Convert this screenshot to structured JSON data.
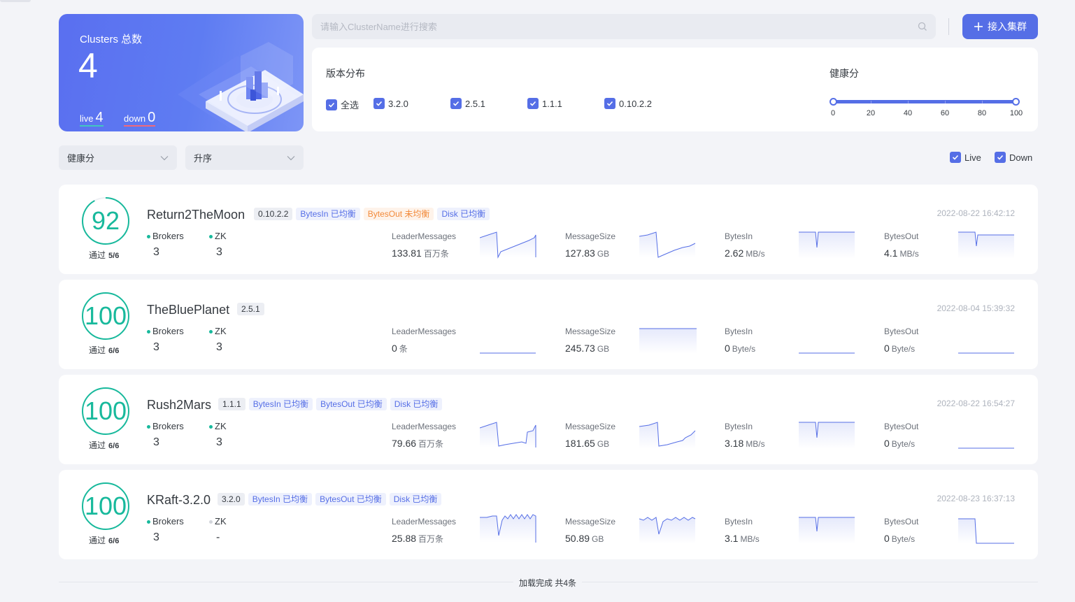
{
  "summary": {
    "title": "Clusters 总数",
    "total": "4",
    "live_label": "live",
    "live_value": "4",
    "down_label": "down",
    "down_value": "0"
  },
  "search": {
    "placeholder": "请输入ClusterName进行搜索"
  },
  "add_button": {
    "label": "接入集群"
  },
  "filters": {
    "version_label": "版本分布",
    "versions": [
      "全选",
      "3.2.0",
      "2.5.1",
      "1.1.1",
      "0.10.2.2"
    ],
    "health_label": "健康分",
    "health_ticks": [
      "0",
      "20",
      "40",
      "60",
      "80",
      "100"
    ],
    "health_range": [
      0,
      100
    ]
  },
  "sort": {
    "field": "健康分",
    "order": "升序"
  },
  "status_filter": {
    "live": "Live",
    "down": "Down"
  },
  "colors": {
    "accent": "#556ee6",
    "health": "#18b99c",
    "warn": "#f28a3a"
  },
  "clusters": [
    {
      "score": "92",
      "pass_label": "通过",
      "pass": "5/6",
      "name": "Return2TheMoon",
      "tags": [
        {
          "text": "0.10.2.2",
          "kind": "ver"
        },
        {
          "text": "BytesIn 已均衡",
          "kind": "ok"
        },
        {
          "text": "BytesOut 未均衡",
          "kind": "warn"
        },
        {
          "text": "Disk 已均衡",
          "kind": "ok"
        }
      ],
      "time": "2022-08-22 16:42:12",
      "brokers_label": "Brokers",
      "brokers": "3",
      "zk_label": "ZK",
      "zk": "3",
      "metrics": [
        {
          "label": "LeaderMessages",
          "value": "133.81",
          "unit": "百万条"
        },
        {
          "label": "MessageSize",
          "value": "127.83",
          "unit": "GB"
        },
        {
          "label": "BytesIn",
          "value": "2.62",
          "unit": "MB/s"
        },
        {
          "label": "BytesOut",
          "value": "4.1",
          "unit": "MB/s"
        }
      ]
    },
    {
      "score": "100",
      "pass_label": "通过",
      "pass": "6/6",
      "name": "TheBluePlanet",
      "tags": [
        {
          "text": "2.5.1",
          "kind": "ver"
        }
      ],
      "time": "2022-08-04 15:39:32",
      "brokers_label": "Brokers",
      "brokers": "3",
      "zk_label": "ZK",
      "zk": "3",
      "metrics": [
        {
          "label": "LeaderMessages",
          "value": "0",
          "unit": "条"
        },
        {
          "label": "MessageSize",
          "value": "245.73",
          "unit": "GB"
        },
        {
          "label": "BytesIn",
          "value": "0",
          "unit": "Byte/s"
        },
        {
          "label": "BytesOut",
          "value": "0",
          "unit": "Byte/s"
        }
      ]
    },
    {
      "score": "100",
      "pass_label": "通过",
      "pass": "6/6",
      "name": "Rush2Mars",
      "tags": [
        {
          "text": "1.1.1",
          "kind": "ver"
        },
        {
          "text": "BytesIn 已均衡",
          "kind": "ok"
        },
        {
          "text": "BytesOut 已均衡",
          "kind": "ok"
        },
        {
          "text": "Disk 已均衡",
          "kind": "ok"
        }
      ],
      "time": "2022-08-22 16:54:27",
      "brokers_label": "Brokers",
      "brokers": "3",
      "zk_label": "ZK",
      "zk": "3",
      "metrics": [
        {
          "label": "LeaderMessages",
          "value": "79.66",
          "unit": "百万条"
        },
        {
          "label": "MessageSize",
          "value": "181.65",
          "unit": "GB"
        },
        {
          "label": "BytesIn",
          "value": "3.18",
          "unit": "MB/s"
        },
        {
          "label": "BytesOut",
          "value": "0",
          "unit": "Byte/s"
        }
      ]
    },
    {
      "score": "100",
      "pass_label": "通过",
      "pass": "6/6",
      "name": "KRaft-3.2.0",
      "tags": [
        {
          "text": "3.2.0",
          "kind": "ver"
        },
        {
          "text": "BytesIn 已均衡",
          "kind": "ok"
        },
        {
          "text": "BytesOut 已均衡",
          "kind": "ok"
        },
        {
          "text": "Disk 已均衡",
          "kind": "ok"
        }
      ],
      "time": "2022-08-23 16:37:13",
      "brokers_label": "Brokers",
      "brokers": "3",
      "zk_label": "ZK",
      "zk": "-",
      "metrics": [
        {
          "label": "LeaderMessages",
          "value": "25.88",
          "unit": "百万条"
        },
        {
          "label": "MessageSize",
          "value": "50.89",
          "unit": "GB"
        },
        {
          "label": "BytesIn",
          "value": "3.1",
          "unit": "MB/s"
        },
        {
          "label": "BytesOut",
          "value": "0",
          "unit": "Byte/s"
        }
      ]
    }
  ],
  "footer": {
    "text": "加载完成 共4条"
  }
}
